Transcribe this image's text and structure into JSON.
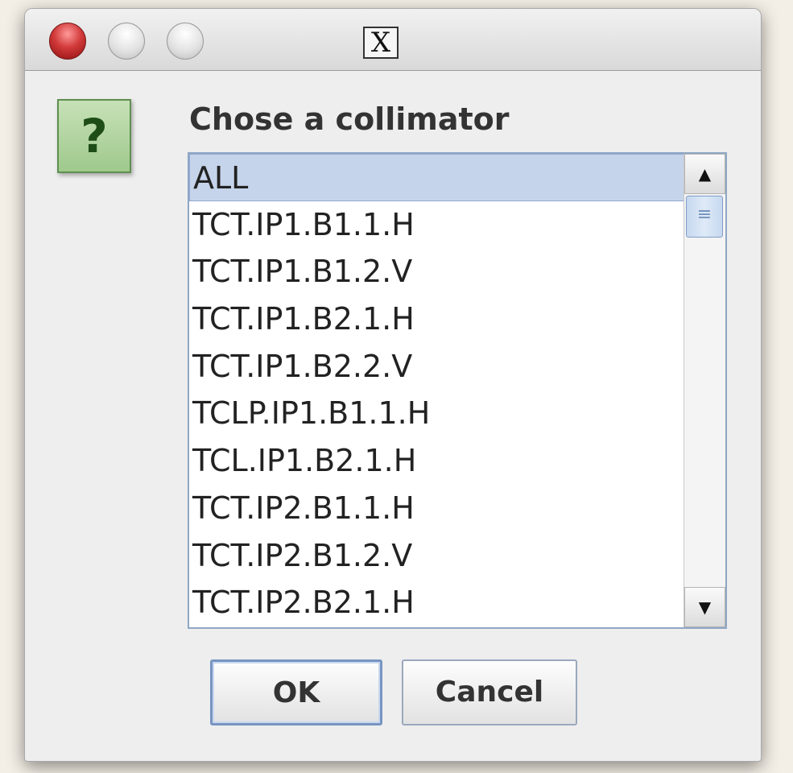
{
  "titlebar": {
    "title_glyph": "X",
    "controls": [
      "close-icon",
      "minimize-icon",
      "maximize-icon"
    ]
  },
  "dialog": {
    "icon_glyph": "?",
    "prompt": "Chose a collimator",
    "list_items": [
      "ALL",
      "TCT.IP1.B1.1.H",
      "TCT.IP1.B1.2.V",
      "TCT.IP1.B2.1.H",
      "TCT.IP1.B2.2.V",
      "TCLP.IP1.B1.1.H",
      "TCL.IP1.B2.1.H",
      "TCT.IP2.B1.1.H",
      "TCT.IP2.B1.2.V",
      "TCT.IP2.B2.1.H"
    ],
    "selected_index": 0,
    "ok_label": "OK",
    "cancel_label": "Cancel"
  },
  "colors": {
    "selection": "#c5d4ea",
    "icon_green": "#9fc98c",
    "close_red": "#d23a3a"
  }
}
